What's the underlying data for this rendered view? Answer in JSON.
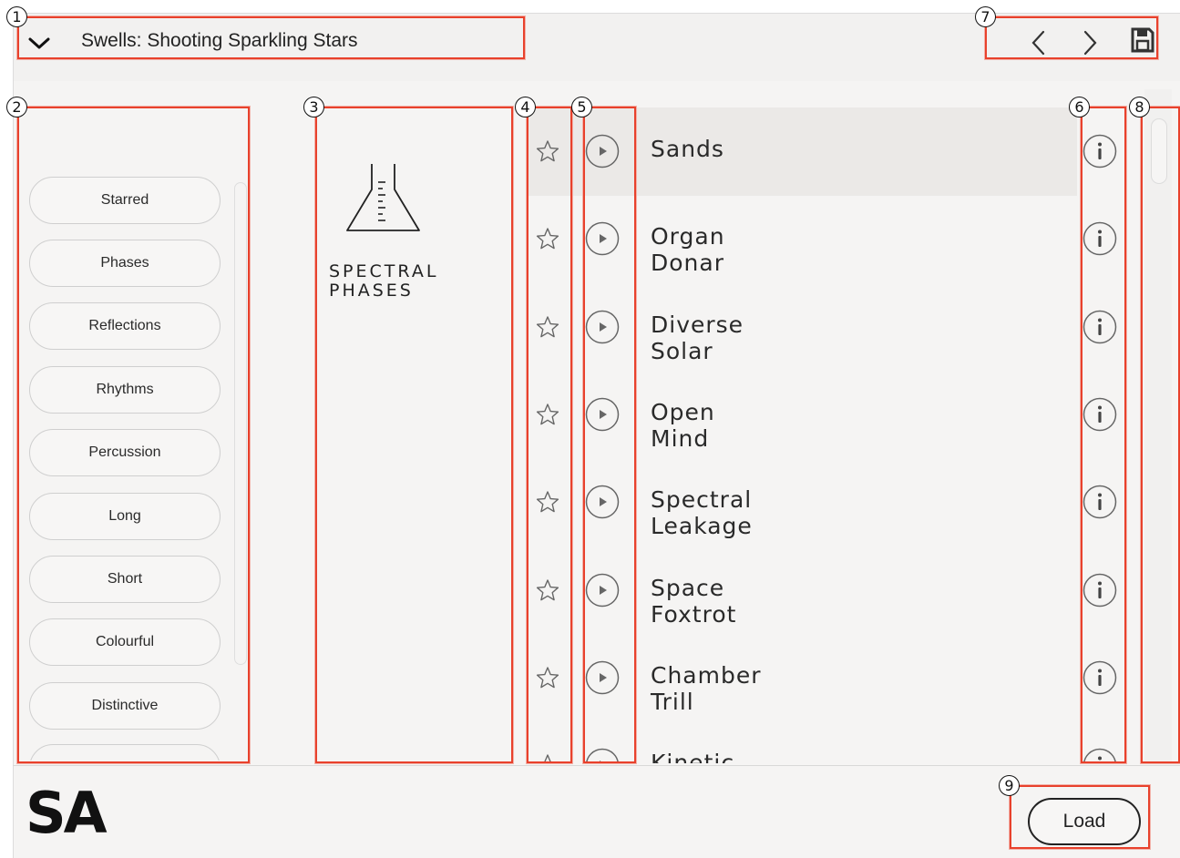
{
  "header": {
    "preset_title": "Swells: Shooting Sparkling Stars",
    "icons": [
      "chevron-down-icon",
      "chevron-left-icon",
      "chevron-right-icon",
      "save-icon"
    ]
  },
  "annotations": [
    "1",
    "2",
    "3",
    "4",
    "5",
    "6",
    "7",
    "8",
    "9"
  ],
  "sidebar": {
    "tags": [
      "Starred",
      "Phases",
      "Reflections",
      "Rhythms",
      "Percussion",
      "Long",
      "Short",
      "Colourful",
      "Distinctive"
    ]
  },
  "product": {
    "name_line1": "SPECTRAL",
    "name_line2": "PHASES",
    "icon": "flask-icon"
  },
  "presets": [
    {
      "name": "Sands",
      "selected": true
    },
    {
      "name": "Organ Donar",
      "selected": false
    },
    {
      "name": "Diverse Solar",
      "selected": false
    },
    {
      "name": "Open Mind",
      "selected": false
    },
    {
      "name": "Spectral Leakage",
      "selected": false
    },
    {
      "name": "Space Foxtrot",
      "selected": false
    },
    {
      "name": "Chamber Trill",
      "selected": false
    },
    {
      "name": "Kinetic Fibre",
      "selected": false
    }
  ],
  "footer": {
    "logo": "SA",
    "load_label": "Load"
  },
  "colors": {
    "annotation": "#e8412c",
    "selected_row": "#ebe9e7",
    "background": "#f5f4f3"
  }
}
